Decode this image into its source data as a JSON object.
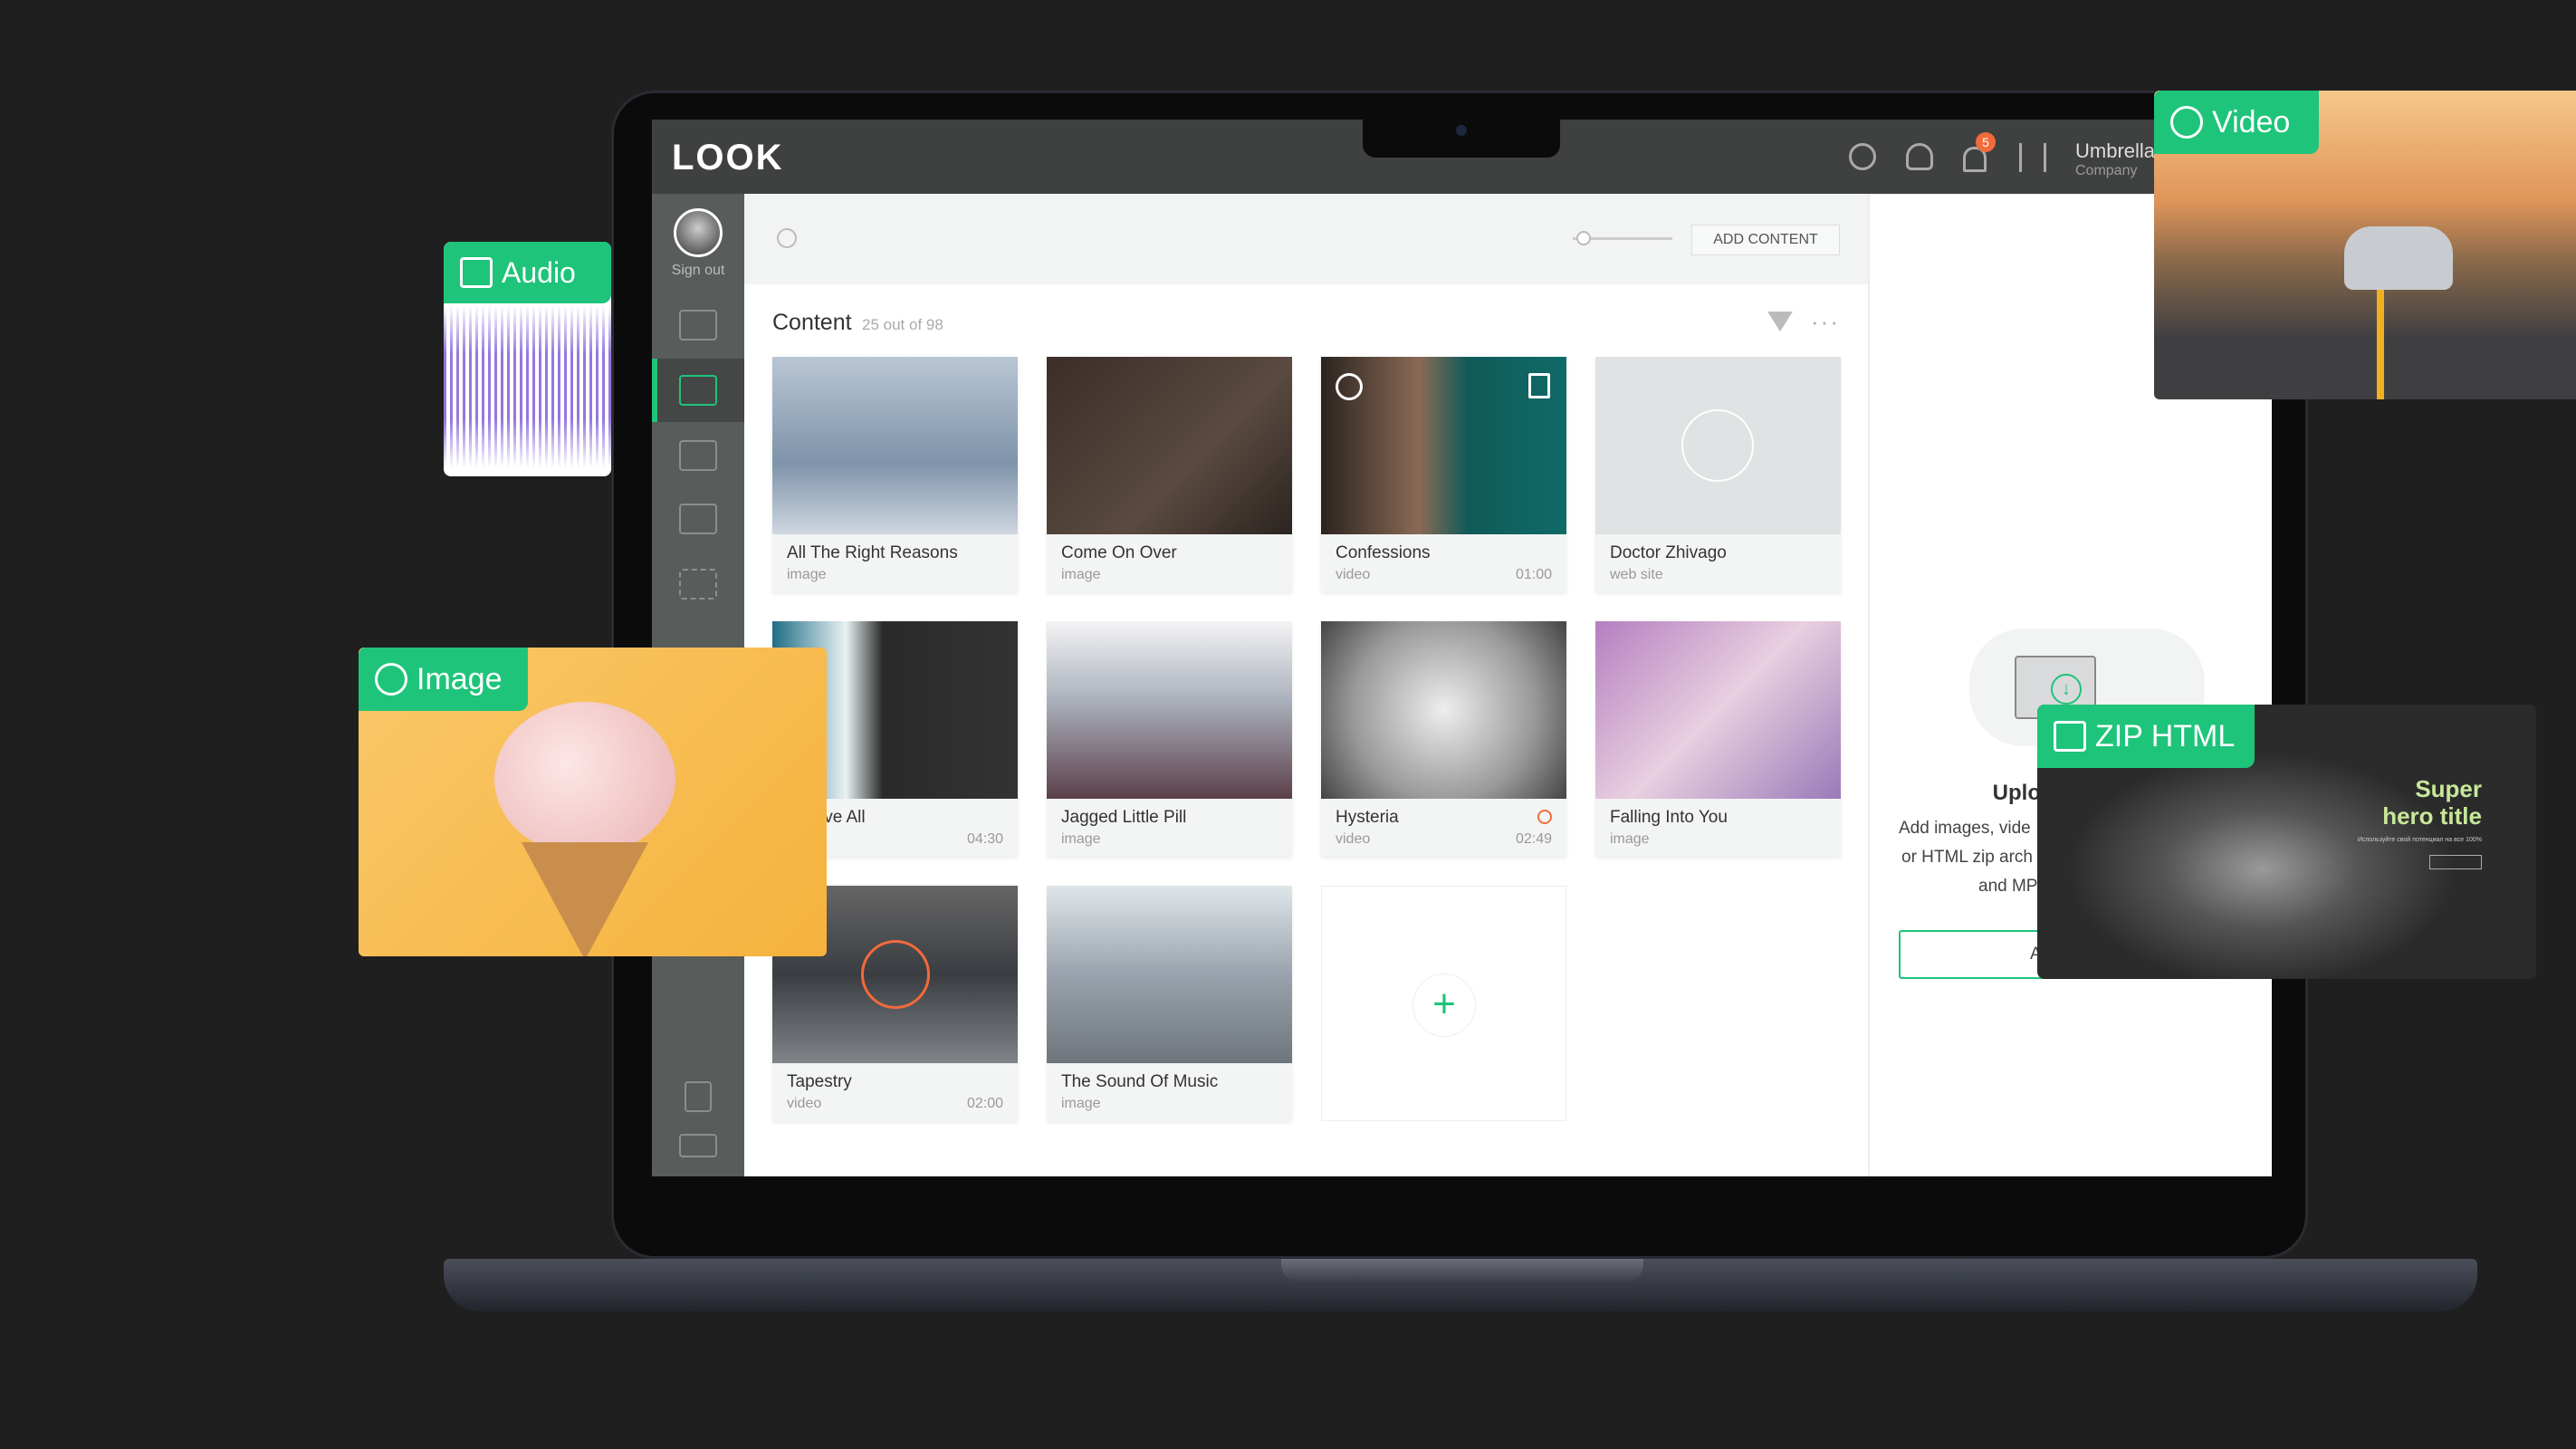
{
  "app": {
    "logo": "LOOK",
    "user_name": "Umbrella",
    "user_role": "Company",
    "notification_count": "5",
    "accent": "#1ec47a"
  },
  "sidebar": {
    "sign_out": "Sign out",
    "items": [
      "screens",
      "media",
      "playlists",
      "schedule",
      "effects",
      "layers",
      "docs",
      "chat"
    ],
    "active": "media"
  },
  "toolbar": {
    "add_content": "ADD CONTENT",
    "zoom_slider_value": 0.1
  },
  "content": {
    "title": "Content",
    "count": "25 out of 98",
    "cards": [
      {
        "title": "All The Right Reasons",
        "type": "image",
        "duration": ""
      },
      {
        "title": "Come On Over",
        "type": "image",
        "duration": ""
      },
      {
        "title": "Confessions",
        "type": "video",
        "duration": "01:00"
      },
      {
        "title": "Doctor Zhivago",
        "type": "web site",
        "duration": ""
      },
      {
        "title": "e Gave All",
        "type": "",
        "duration": "04:30"
      },
      {
        "title": "Jagged Little Pill",
        "type": "image",
        "duration": ""
      },
      {
        "title": "Hysteria",
        "type": "video",
        "duration": "02:49"
      },
      {
        "title": "Falling Into You",
        "type": "image",
        "duration": ""
      },
      {
        "title": "Tapestry",
        "type": "video",
        "duration": "02:00"
      },
      {
        "title": "The Sound Of Music",
        "type": "image",
        "duration": ""
      }
    ]
  },
  "upload": {
    "title": "Upload content",
    "line1": "Add images, vide",
    "line2": "or HTML zip arch",
    "line3": "and MP",
    "button": "ADD"
  },
  "overlays": {
    "audio": "Audio",
    "image": "Image",
    "video": "Video",
    "zip": "ZIP HTML",
    "zip_hero_line1": "Super",
    "zip_hero_line2": "hero title",
    "zip_hero_sub": "Используйте свой потенциал на все 100%"
  }
}
